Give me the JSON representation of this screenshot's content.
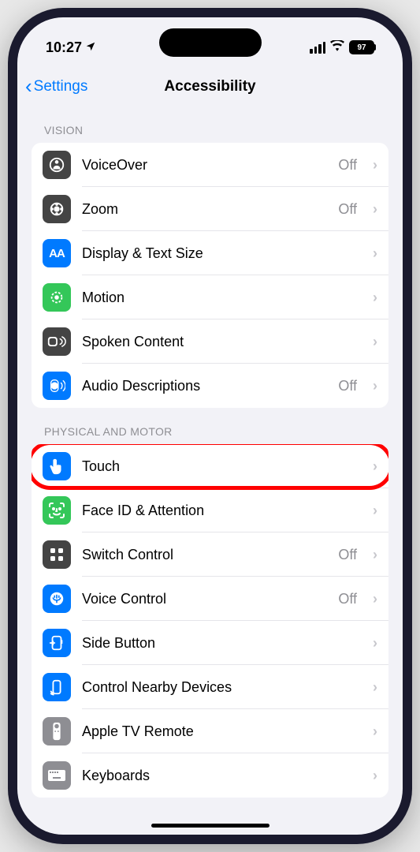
{
  "statusBar": {
    "time": "10:27",
    "battery": "97"
  },
  "nav": {
    "back": "Settings",
    "title": "Accessibility"
  },
  "sections": {
    "vision": {
      "header": "VISION",
      "voiceover": {
        "label": "VoiceOver",
        "status": "Off"
      },
      "zoom": {
        "label": "Zoom",
        "status": "Off"
      },
      "display": {
        "label": "Display & Text Size"
      },
      "motion": {
        "label": "Motion"
      },
      "spoken": {
        "label": "Spoken Content"
      },
      "audio": {
        "label": "Audio Descriptions",
        "status": "Off"
      }
    },
    "physical": {
      "header": "PHYSICAL AND MOTOR",
      "touch": {
        "label": "Touch"
      },
      "faceid": {
        "label": "Face ID & Attention"
      },
      "switch": {
        "label": "Switch Control",
        "status": "Off"
      },
      "voice": {
        "label": "Voice Control",
        "status": "Off"
      },
      "side": {
        "label": "Side Button"
      },
      "nearby": {
        "label": "Control Nearby Devices"
      },
      "appletv": {
        "label": "Apple TV Remote"
      },
      "keyboards": {
        "label": "Keyboards"
      }
    }
  },
  "colors": {
    "ios_blue": "#007aff",
    "ios_gray": "#8e8e93",
    "ios_green": "#34c759",
    "dark_gray": "#5e5e5e",
    "highlight": "#ff0000"
  }
}
